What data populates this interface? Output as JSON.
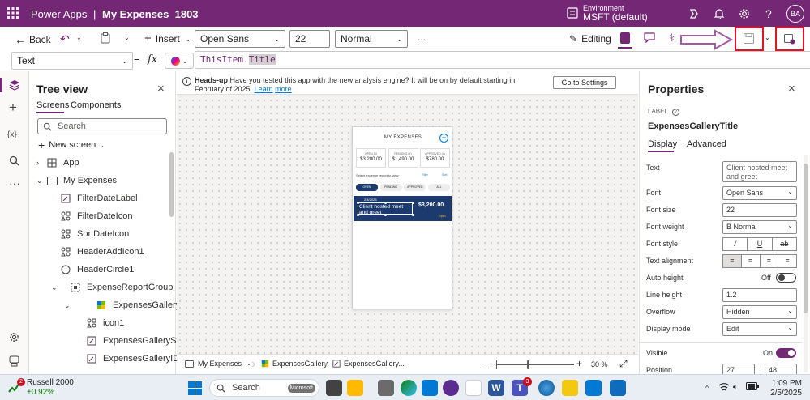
{
  "header": {
    "app_name": "Power Apps",
    "separator": "|",
    "file_name": "My Expenses_1803",
    "env_label": "Environment",
    "env_name": "MSFT (default)",
    "avatar": "BA",
    "icons": [
      "environment-icon",
      "copilot-icon",
      "bell-icon",
      "gear-icon",
      "help-icon"
    ]
  },
  "toolbar": {
    "back": "Back",
    "insert": "Insert",
    "font": "Open Sans",
    "size": "22",
    "weight": "Normal",
    "more": "...",
    "editing": "Editing"
  },
  "formula": {
    "property": "Text",
    "fx": "fx",
    "expr_part1": "ThisItem.",
    "expr_part2": "Title"
  },
  "tree": {
    "title": "Tree view",
    "tabs": [
      "Screens",
      "Components"
    ],
    "search_placeholder": "Search",
    "new_screen": "New screen",
    "rows": [
      "App",
      "My Expenses",
      "FilterDateLabel",
      "FilterDateIcon",
      "SortDateIcon",
      "HeaderAddIcon1",
      "HeaderCircle1",
      "ExpenseReportGroup",
      "ExpensesGallery",
      "icon1",
      "ExpensesGalleryStatus",
      "ExpensesGalleryID"
    ]
  },
  "banner": {
    "bold": "Heads-up",
    "text": "Have you tested this app with the new analysis engine? It will be on by default starting in February of 2025.",
    "link1": "Learn",
    "link2": "more",
    "button": "Go to Settings"
  },
  "app_preview": {
    "title": "MY EXPENSES",
    "stats": [
      {
        "label": "OPEN (1)",
        "value": "$3,200.00"
      },
      {
        "label": "PENDING (1)",
        "value": "$1,490.00"
      },
      {
        "label": "APPROVED (2)",
        "value": "$780.00"
      }
    ],
    "select_text": "Select expense report to view",
    "filter": "Filter",
    "sort": "Sort",
    "tabs": [
      "OPEN",
      "PENDING",
      "APPROVED",
      "ALL"
    ],
    "item": {
      "date": "2/4/2025",
      "title": "Client hosted meet and greet",
      "amount": "$3,200.00",
      "status": "Open"
    }
  },
  "bottom_bar": {
    "crumbs": [
      "My Expenses",
      "ExpensesGallery",
      "ExpensesGallery..."
    ],
    "zoom": "30",
    "zoom_unit": "%"
  },
  "properties": {
    "title": "Properties",
    "type": "LABEL",
    "control": "ExpensesGalleryTitle",
    "tabs": [
      "Display",
      "Advanced"
    ],
    "text_label": "Text",
    "text_value": "Client hosted meet and greet",
    "font_label": "Font",
    "font_value": "Open Sans",
    "font_size_label": "Font size",
    "font_size_value": "22",
    "font_weight_label": "Font weight",
    "font_weight_value": "B  Normal",
    "font_style_label": "Font style",
    "text_align_label": "Text alignment",
    "auto_height_label": "Auto height",
    "auto_height_value": "Off",
    "line_height_label": "Line height",
    "line_height_value": "1.2",
    "overflow_label": "Overflow",
    "overflow_value": "Hidden",
    "display_mode_label": "Display mode",
    "display_mode_value": "Edit",
    "visible_label": "Visible",
    "visible_value": "On",
    "position_label": "Position",
    "position_x": "27",
    "position_y": "48"
  },
  "taskbar": {
    "ticker_name": "Russell 2000",
    "ticker_change": "+0.92%",
    "ticker_badge": "2",
    "search": "Search",
    "search_brand": "Microsoft",
    "teams_badge": "3",
    "time": "1:09 PM",
    "date": "2/5/2025"
  },
  "colors": {
    "brand": "#742774",
    "accent": "#0078d4",
    "highlight": "#e81123",
    "arrow": "#a55aa6"
  }
}
